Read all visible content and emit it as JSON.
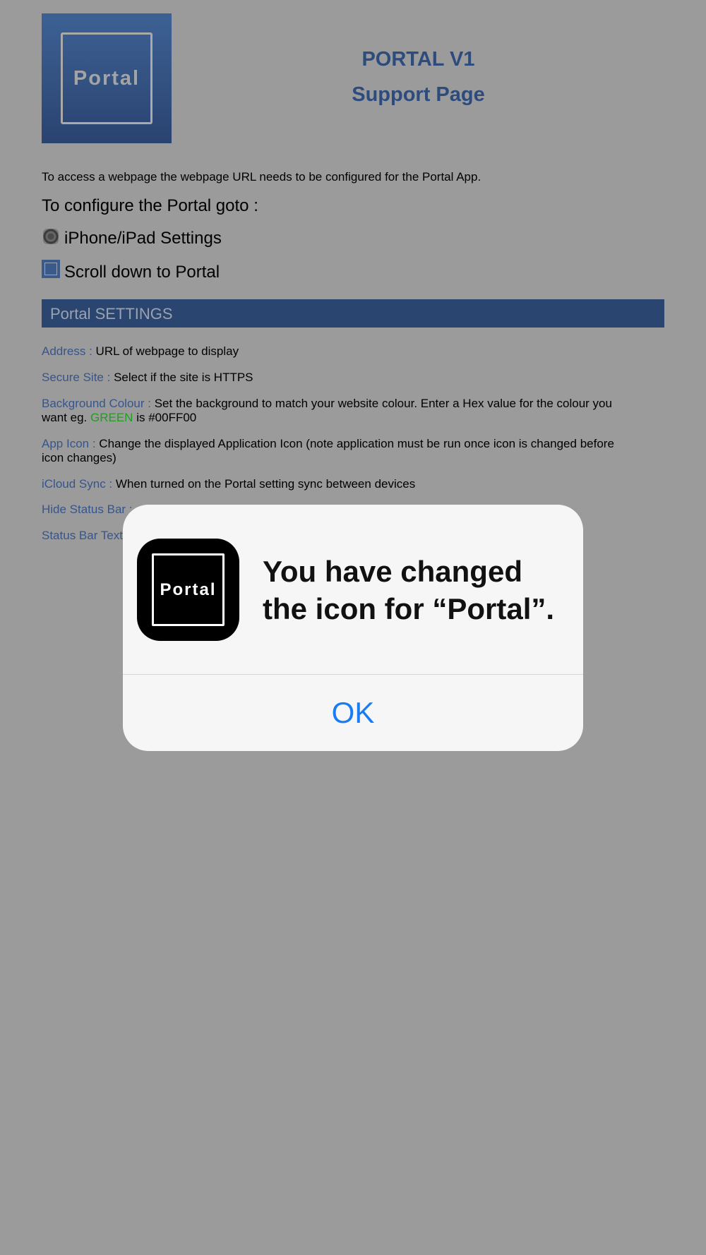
{
  "header": {
    "logo_text": "Portal",
    "title": "PORTAL V1",
    "subtitle": "Support Page"
  },
  "intro": "To access a webpage the webpage URL needs to be configured for the  Portal App.",
  "configure_heading": "To configure the Portal  goto :",
  "steps": [
    {
      "icon": "settings-icon",
      "text": "iPhone/iPad Settings"
    },
    {
      "icon": "portal-app-icon",
      "text": "Scroll down to Portal"
    }
  ],
  "section_title": "Portal SETTINGS",
  "settings": [
    {
      "label": "Address :",
      "text": "URL of webpage to display"
    },
    {
      "label": "Secure Site :",
      "text": "Select if the site is HTTPS"
    },
    {
      "label": "Background Colour :",
      "text": "Set the background to match your website colour. Enter a Hex value for the colour you want eg.",
      "highlight": "GREEN",
      "tail": "is #00FF00"
    },
    {
      "label": "App Icon :",
      "text": "Change the displayed Application Icon (note application must be run once icon is changed before icon changes)"
    },
    {
      "label": "iCloud Sync :",
      "text": "When turned on the Portal setting sync between devices"
    },
    {
      "label": "Hide Status Bar :",
      "text": ""
    },
    {
      "label": "Status Bar Text",
      "text": ""
    }
  ],
  "alert": {
    "icon_text": "Portal",
    "message": "You have changed the icon for “Portal”.",
    "ok_label": "OK"
  },
  "colors": {
    "background": "#9b9b9b",
    "title_blue": "#2d4b7c",
    "label_blue": "#37558a",
    "section_bar": "#2a4670",
    "green": "#1ea01e",
    "ok_blue": "#1a7cf3"
  }
}
